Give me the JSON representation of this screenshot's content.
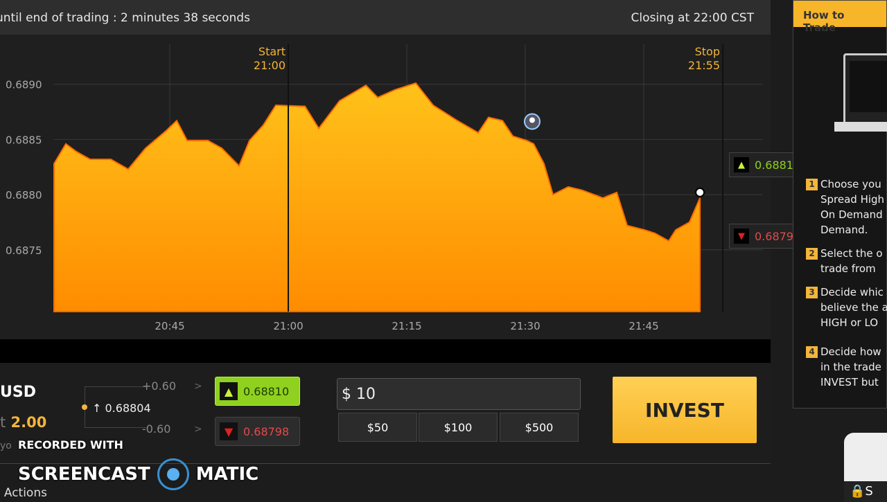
{
  "topbar": {
    "countdown": "until end of trading : 2 minutes 38 seconds",
    "closing": "Closing at 22:00 CST"
  },
  "chart_data": {
    "type": "area",
    "y_ticks": [
      "0.6890",
      "0.6885",
      "0.6880",
      "0.6875"
    ],
    "x_ticks": [
      "20:45",
      "21:00",
      "21:15",
      "21:30",
      "21:45"
    ],
    "ylim": [
      0.68694,
      0.68945
    ],
    "x_unit": "minutes after 20:30",
    "xlim": [
      0,
      95.4
    ],
    "x_tick_minutes": [
      15,
      30,
      45,
      60,
      75
    ],
    "start_marker": {
      "label": "Start",
      "time": "21:00",
      "minute": 30
    },
    "stop_marker": {
      "label": "Stop",
      "time": "21:55",
      "minute": 85
    },
    "series": [
      [
        0.35,
        0.68828
      ],
      [
        1.84,
        0.68846
      ],
      [
        3.16,
        0.68839
      ],
      [
        4.91,
        0.68832
      ],
      [
        7.54,
        0.68832
      ],
      [
        9.74,
        0.68823
      ],
      [
        11.93,
        0.68842
      ],
      [
        14.56,
        0.68858
      ],
      [
        15.88,
        0.68867
      ],
      [
        17.19,
        0.68849
      ],
      [
        19.82,
        0.68849
      ],
      [
        21.58,
        0.68842
      ],
      [
        23.77,
        0.68826
      ],
      [
        25.09,
        0.68849
      ],
      [
        26.84,
        0.68863
      ],
      [
        28.42,
        0.68881
      ],
      [
        32.11,
        0.6888
      ],
      [
        33.86,
        0.6886
      ],
      [
        36.49,
        0.68885
      ],
      [
        39.82,
        0.68899
      ],
      [
        41.32,
        0.68888
      ],
      [
        43.51,
        0.68895
      ],
      [
        46.14,
        0.68901
      ],
      [
        48.33,
        0.68881
      ],
      [
        51.4,
        0.68867
      ],
      [
        54.04,
        0.68856
      ],
      [
        55.35,
        0.6887
      ],
      [
        57.11,
        0.68867
      ],
      [
        58.42,
        0.68853
      ],
      [
        60.18,
        0.68849
      ],
      [
        61.05,
        0.68846
      ],
      [
        62.37,
        0.68828
      ],
      [
        63.51,
        0.688
      ],
      [
        65.44,
        0.68807
      ],
      [
        67.19,
        0.68804
      ],
      [
        69.82,
        0.68797
      ],
      [
        71.58,
        0.68802
      ],
      [
        72.89,
        0.68772
      ],
      [
        75.09,
        0.68768
      ],
      [
        76.4,
        0.68765
      ],
      [
        78.16,
        0.68758
      ],
      [
        79.04,
        0.68768
      ],
      [
        80.79,
        0.68775
      ],
      [
        82.11,
        0.68797
      ]
    ],
    "pin_minute": 61.05,
    "high_price": "0.68810",
    "low_price": "0.68798"
  },
  "colors": {
    "area": "#ffa500",
    "accent": "#f3b53a",
    "high": "#8fd11e",
    "low": "#e24a4a"
  },
  "trade": {
    "asset": "USD",
    "payout_prefix": "t",
    "payout": "2.00",
    "yo": "yo",
    "current": "0.68804",
    "spread_up": "+0.60",
    "spread_down": "-0.60",
    "gt": ">",
    "high_button": "0.68810",
    "low_button": "0.68798",
    "amount_value": "$ 10",
    "quick_amounts": [
      "$50",
      "$100",
      "$500"
    ],
    "invest_label": "INVEST"
  },
  "actions_label": "e Actions",
  "watermark": {
    "line1": "RECORDED WITH",
    "left": "SCREENCAST",
    "right": "MATIC"
  },
  "sidebar": {
    "title": "How to Trade",
    "steps": [
      {
        "n": "1",
        "text": "Choose you\nSpread High\nOn Demand\nDemand."
      },
      {
        "n": "2",
        "text": "Select the o\ntrade from"
      },
      {
        "n": "3",
        "text": "Decide whic\nbelieve the a\nHIGH or LO"
      },
      {
        "n": "4",
        "text": "Decide how\nin the trade\nINVEST but"
      }
    ],
    "secure_label": "S"
  }
}
